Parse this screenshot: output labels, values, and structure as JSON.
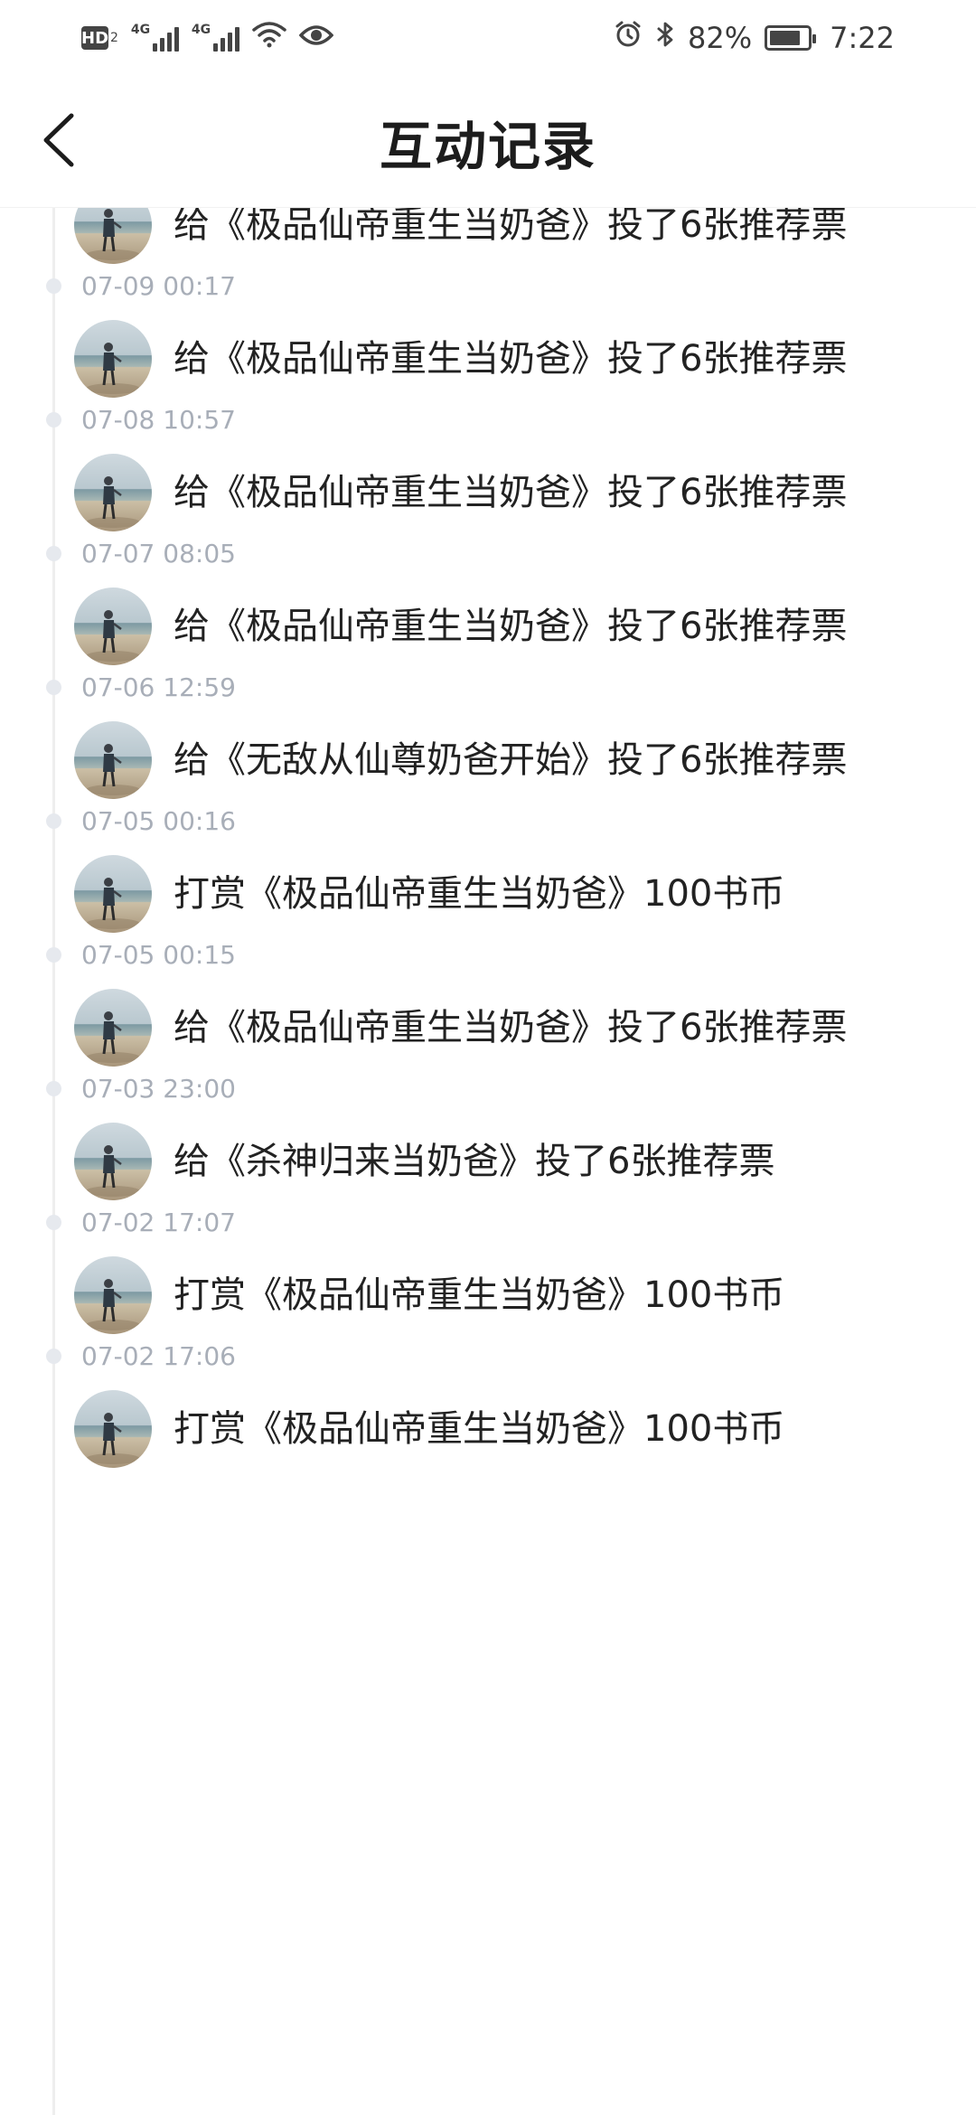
{
  "status_bar": {
    "hd": "HD",
    "hd_sub": "2",
    "network_1": "4G",
    "network_2": "4G",
    "battery_percent": "82%",
    "battery_level": 0.82,
    "time": "7:22",
    "icons": [
      "wifi-icon",
      "eye-icon",
      "alarm-icon",
      "bluetooth-icon",
      "battery-icon"
    ]
  },
  "header": {
    "title": "互动记录",
    "back_icon": "chevron-left-icon"
  },
  "records": [
    {
      "time": "",
      "text": "给《极品仙帝重生当奶爸》投了6张推荐票"
    },
    {
      "time": "07-09 00:17",
      "text": "给《极品仙帝重生当奶爸》投了6张推荐票"
    },
    {
      "time": "07-08 10:57",
      "text": "给《极品仙帝重生当奶爸》投了6张推荐票"
    },
    {
      "time": "07-07 08:05",
      "text": "给《极品仙帝重生当奶爸》投了6张推荐票"
    },
    {
      "time": "07-06 12:59",
      "text": "给《无敌从仙尊奶爸开始》投了6张推荐票"
    },
    {
      "time": "07-05 00:16",
      "text": "打赏《极品仙帝重生当奶爸》100书币"
    },
    {
      "time": "07-05 00:15",
      "text": "给《极品仙帝重生当奶爸》投了6张推荐票"
    },
    {
      "time": "07-03 23:00",
      "text": "给《杀神归来当奶爸》投了6张推荐票"
    },
    {
      "time": "07-02 17:07",
      "text": "打赏《极品仙帝重生当奶爸》100书币"
    },
    {
      "time": "07-02 17:06",
      "text": "打赏《极品仙帝重生当奶爸》100书币"
    }
  ]
}
